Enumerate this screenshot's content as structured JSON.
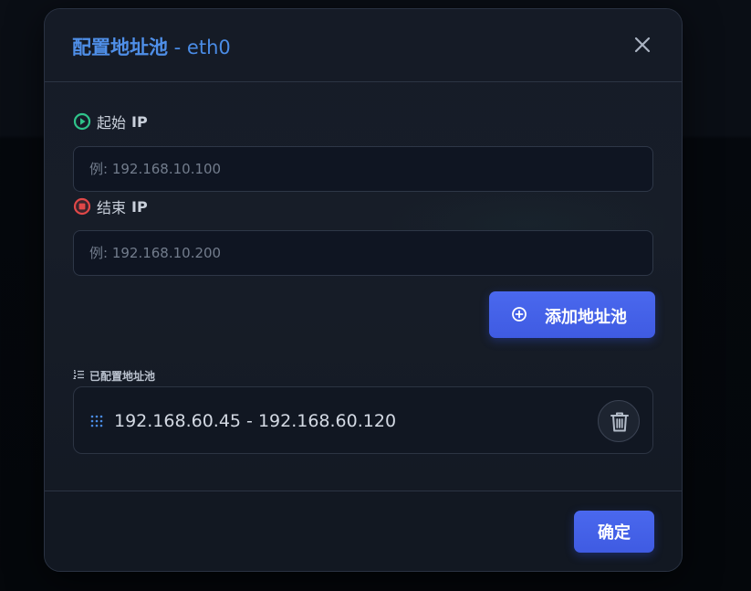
{
  "dialog": {
    "title": "配置地址池",
    "title_suffix": " - eth0",
    "close_icon": "close-icon"
  },
  "start_ip": {
    "label": "起始",
    "label_strong": "IP",
    "value": "",
    "placeholder": "例: 192.168.10.100",
    "icon": "play-circle-icon",
    "icon_color": "#2fc38a"
  },
  "end_ip": {
    "label": "结束",
    "label_strong": "IP",
    "value": "",
    "placeholder": "例: 192.168.10.200",
    "icon": "stop-circle-icon",
    "icon_color": "#e04848"
  },
  "add_button": {
    "label": "添加地址池",
    "icon": "plus-circle-icon"
  },
  "configured": {
    "label": "已配置地址池",
    "icon": "list-ordered-icon",
    "pools": [
      {
        "range": "192.168.60.45 - 192.168.60.120"
      }
    ]
  },
  "footer": {
    "ok_label": "确定"
  },
  "colors": {
    "accent": "#4361e8",
    "title": "#4f8fe8",
    "start": "#2fc38a",
    "end": "#e04848"
  }
}
